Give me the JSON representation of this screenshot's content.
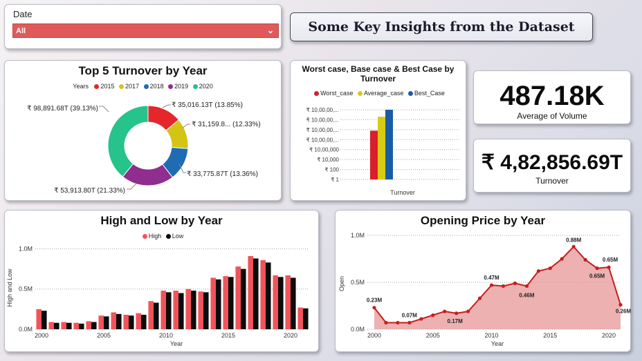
{
  "slicer": {
    "label": "Date",
    "value": "All"
  },
  "header": {
    "title": "Some Key Insights from the Dataset"
  },
  "kpis": [
    {
      "value": "487.18K",
      "label": "Average of Volume"
    },
    {
      "value": "₹ 4,82,856.69T",
      "label": "Turnover"
    }
  ],
  "colors": {
    "y2015": "#e5262b",
    "y2017": "#d4c414",
    "y2018": "#1f6bb4",
    "y2019": "#8f2e8f",
    "y2020": "#26c38b",
    "worst": "#d7202a",
    "average": "#d6cc13",
    "best": "#1b5ca7",
    "high": "#f0545a",
    "low": "#0b0b0b",
    "open": "#c81d1d",
    "open_fill": "#e69090"
  },
  "donut": {
    "title": "Top 5 Turnover by Year",
    "legend_title": "Years",
    "chart_data": {
      "type": "pie",
      "categories": [
        "2015",
        "2017",
        "2018",
        "2019",
        "2020"
      ],
      "values": [
        35016.13,
        31159.8,
        33775.87,
        53913.8,
        98891.68
      ],
      "percent": [
        13.85,
        12.33,
        13.36,
        21.33,
        39.13
      ],
      "labels": [
        "₹ 35,016.13T (13.85%)",
        "₹ 31,159.8... (12.33%)",
        "₹ 33,775.87T (13.36%)",
        "₹ 53,913.80T (21.33%)",
        "₹ 98,891.68T (39.13%)"
      ]
    }
  },
  "cases": {
    "title": "Worst case, Base case & Best Case by Turnover",
    "legend": [
      "Worst_case",
      "Average_case",
      "Best_Case"
    ],
    "chart_data": {
      "type": "bar",
      "categories": [
        "Turnover"
      ],
      "xlabel": "Turnover",
      "yscale": "log",
      "yticks": [
        "₹ 10,00,00,...",
        "₹ 10,00,00,...",
        "₹ 10,00,00,...",
        "₹ 10,00,00,...",
        "₹ 10,00,000",
        "₹ 10,000",
        "₹ 100",
        "₹ 1"
      ],
      "series": [
        {
          "name": "Worst_case",
          "values": [
            7
          ]
        },
        {
          "name": "Average_case",
          "values": [
            9
          ]
        },
        {
          "name": "Best_Case",
          "values": [
            10
          ]
        }
      ]
    }
  },
  "highlow": {
    "title": "High and Low by Year",
    "legend": [
      "High",
      "Low"
    ],
    "chart_data": {
      "type": "bar",
      "xlabel": "Year",
      "ylabel": "High and Low",
      "ylim": [
        0,
        1.15
      ],
      "yticks": [
        "0.0M",
        "0.5M",
        "1.0M"
      ],
      "xticks": [
        "2000",
        "2005",
        "2010",
        "2015",
        "2020"
      ],
      "x": [
        2000,
        2001,
        2002,
        2003,
        2004,
        2005,
        2006,
        2007,
        2008,
        2009,
        2010,
        2011,
        2012,
        2013,
        2014,
        2015,
        2016,
        2017,
        2018,
        2019,
        2020,
        2021
      ],
      "series": [
        {
          "name": "High",
          "values": [
            0.25,
            0.09,
            0.09,
            0.08,
            0.1,
            0.17,
            0.21,
            0.18,
            0.2,
            0.35,
            0.48,
            0.48,
            0.5,
            0.47,
            0.64,
            0.66,
            0.78,
            0.91,
            0.86,
            0.67,
            0.67,
            0.27
          ]
        },
        {
          "name": "Low",
          "values": [
            0.23,
            0.08,
            0.08,
            0.07,
            0.09,
            0.16,
            0.19,
            0.17,
            0.18,
            0.33,
            0.46,
            0.45,
            0.48,
            0.46,
            0.62,
            0.65,
            0.75,
            0.88,
            0.83,
            0.65,
            0.64,
            0.26
          ]
        }
      ]
    }
  },
  "opening": {
    "title": "Opening Price by Year",
    "chart_data": {
      "type": "area",
      "xlabel": "Year",
      "ylabel": "Open",
      "ylim": [
        0,
        1.0
      ],
      "yticks": [
        "0.0M",
        "0.5M",
        "1.0M"
      ],
      "xticks": [
        "2000",
        "2005",
        "2010",
        "2015",
        "2020"
      ],
      "x": [
        2000,
        2001,
        2002,
        2003,
        2004,
        2005,
        2006,
        2007,
        2008,
        2009,
        2010,
        2011,
        2012,
        2013,
        2014,
        2015,
        2016,
        2017,
        2018,
        2019,
        2020,
        2021
      ],
      "values": [
        0.23,
        0.07,
        0.07,
        0.07,
        0.11,
        0.15,
        0.19,
        0.17,
        0.19,
        0.33,
        0.47,
        0.46,
        0.49,
        0.46,
        0.62,
        0.65,
        0.75,
        0.88,
        0.74,
        0.65,
        0.66,
        0.26
      ],
      "data_labels": [
        {
          "index": 0,
          "text": "0.23M"
        },
        {
          "index": 3,
          "text": "0.07M"
        },
        {
          "index": 7,
          "text": "0.17M"
        },
        {
          "index": 10,
          "text": "0.47M"
        },
        {
          "index": 13,
          "text": "0.46M"
        },
        {
          "index": 17,
          "text": "0.88M"
        },
        {
          "index": 19,
          "text": "0.65M"
        },
        {
          "index": 20,
          "text": "0.65M"
        },
        {
          "index": 21,
          "text": "0.26M"
        }
      ]
    }
  }
}
